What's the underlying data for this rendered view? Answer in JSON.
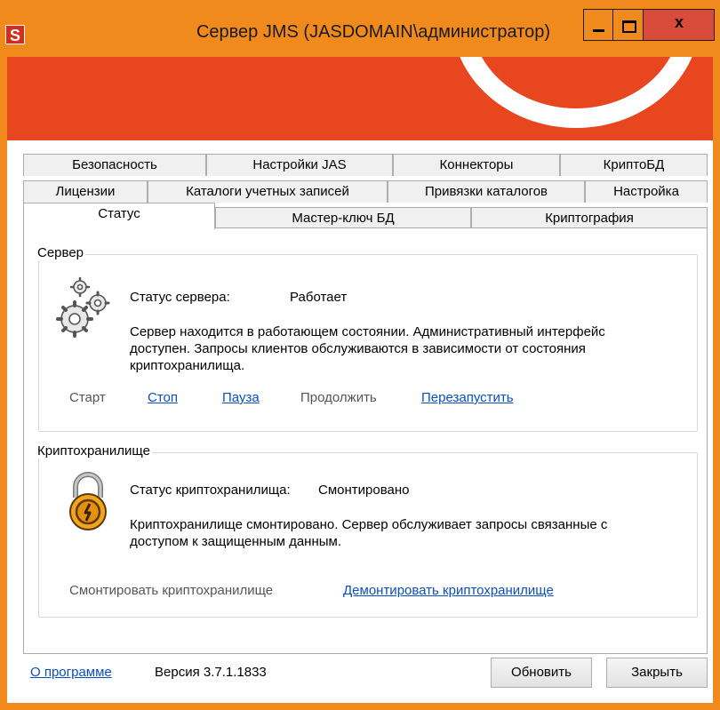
{
  "window": {
    "title": "Сервер JMS (JASDOMAIN\\администратор)",
    "app_icon_letter": "S",
    "close_glyph": "x"
  },
  "tabs": {
    "row1": [
      "Безопасность",
      "Настройки JAS",
      "Коннекторы",
      "КриптоБД"
    ],
    "row2": [
      "Лицензии",
      "Каталоги учетных записей",
      "Привязки каталогов",
      "Настройка"
    ],
    "row3": [
      "Статус",
      "Мастер-ключ БД",
      "Криптография"
    ],
    "active": "Статус"
  },
  "server": {
    "group_title": "Сервер",
    "status_label": "Статус сервера:",
    "status_value": "Работает",
    "description": "Сервер находится в работающем состоянии. Административный интерфейс доступен. Запросы клиентов обслуживаются в зависимости от состояния криптохранилища.",
    "actions": {
      "start": "Старт",
      "stop": "Стоп",
      "pause": "Пауза",
      "resume": "Продолжить",
      "restart": "Перезапустить"
    },
    "icon": "gears-icon"
  },
  "cryptostore": {
    "group_title": "Криптохранилище",
    "status_label": "Статус криптохранилища:",
    "status_value": "Смонтировано",
    "description": "Криптохранилище смонтировано. Сервер обслуживает запросы связанные с доступом к защищенным данным.",
    "actions": {
      "mount": "Смонтировать криптохранилище",
      "unmount": "Демонтировать криптохранилище"
    },
    "icon": "padlock-icon"
  },
  "footer": {
    "about_link": "О программе",
    "version": "Версия 3.7.1.1833",
    "refresh_button": "Обновить",
    "close_button": "Закрыть"
  },
  "colors": {
    "accent_orange": "#f08a1c",
    "banner": "#e8461e",
    "link": "#0a4fc0",
    "close_button": "#d94c3c"
  }
}
